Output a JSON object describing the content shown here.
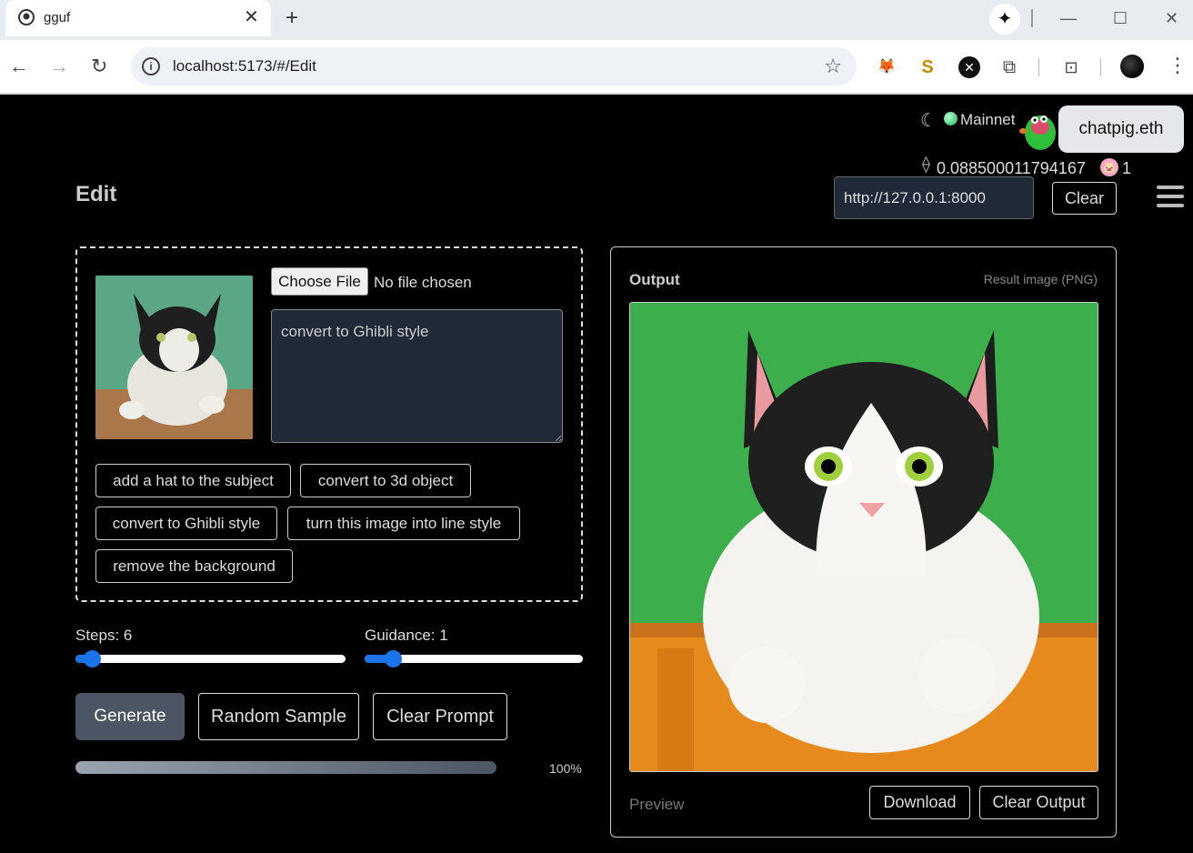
{
  "browser": {
    "tab_title": "gguf",
    "url": "localhost:5173/#/Edit"
  },
  "header": {
    "network": "Mainnet",
    "ens": "chatpig.eth",
    "balance": "0.088500011794167",
    "pig_count": "1",
    "page_title": "Edit",
    "api_url": "http://127.0.0.1:8000",
    "clear_label": "Clear"
  },
  "input": {
    "choose_file_label": "Choose File",
    "no_file_text": "No file chosen",
    "prompt": "convert to Ghibli style",
    "presets": [
      "add a hat to the subject",
      "convert to 3d object",
      "convert to Ghibli style",
      "turn this image into line style",
      "remove the background"
    ]
  },
  "controls": {
    "steps_label": "Steps: 6",
    "steps_fraction": 0.06,
    "guidance_label": "Guidance: 1",
    "guidance_fraction": 0.13,
    "generate_label": "Generate",
    "random_label": "Random Sample",
    "clear_prompt_label": "Clear Prompt",
    "progress_percent": 100,
    "progress_text": "100%"
  },
  "output": {
    "title": "Output",
    "meta": "Result image (PNG)",
    "preview_label": "Preview",
    "download_label": "Download",
    "clear_output_label": "Clear Output"
  },
  "colors": {
    "accent": "#1a73e8",
    "panel_bg": "#1f2937",
    "generate_bg": "#4b5563"
  }
}
